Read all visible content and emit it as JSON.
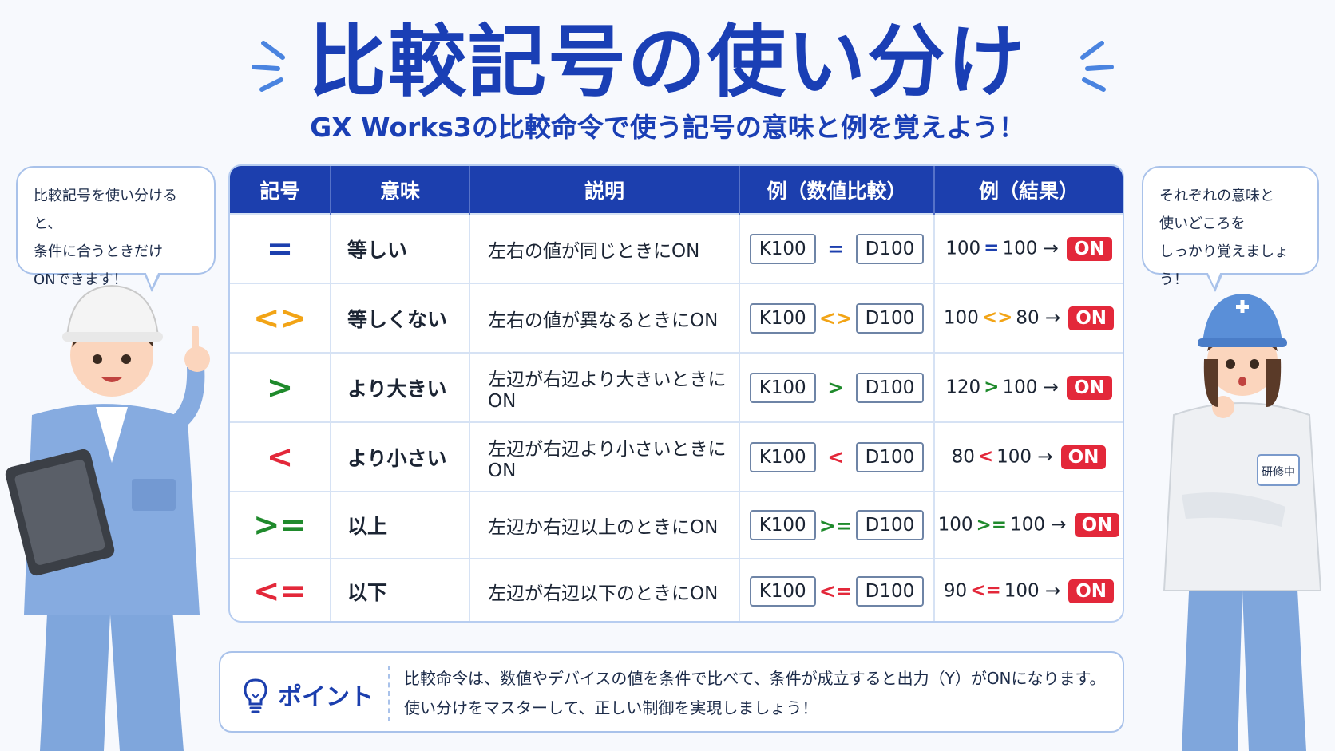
{
  "title": "比較記号の使い分け",
  "subtitle": "GX Works3の比較命令で使う記号の意味と例を覚えよう！",
  "bubble_left": [
    "比較記号を使い分けると、",
    "条件に合うときだけ",
    "ONできます！"
  ],
  "bubble_right": [
    "それぞれの意味と",
    "使いどころを",
    "しっかり覚えましょう！"
  ],
  "table": {
    "headers": [
      "記号",
      "意味",
      "説明",
      "例（数値比較）",
      "例（結果）"
    ],
    "rows": [
      {
        "symbol": "=",
        "color": "#1c3fae",
        "meaning": "等しい",
        "desc": "左右の値が同じときにON",
        "ex_left": "K100",
        "ex_right": "D100",
        "res_left": "100",
        "res_right": "100",
        "arrow": "→",
        "on": "ON"
      },
      {
        "symbol": "<>",
        "color": "#f2a416",
        "meaning": "等しくない",
        "desc": "左右の値が異なるときにON",
        "ex_left": "K100",
        "ex_right": "D100",
        "res_left": "100",
        "res_right": "80",
        "arrow": "→",
        "on": "ON"
      },
      {
        "symbol": ">",
        "color": "#1f8a2c",
        "meaning": "より大きい",
        "desc": "左辺が右辺より大きいときにON",
        "ex_left": "K100",
        "ex_right": "D100",
        "res_left": "120",
        "res_right": "100",
        "arrow": "→",
        "on": "ON"
      },
      {
        "symbol": "<",
        "color": "#e3283a",
        "meaning": "より小さい",
        "desc": "左辺が右辺より小さいときにON",
        "ex_left": "K100",
        "ex_right": "D100",
        "res_left": "80",
        "res_right": "100",
        "arrow": "→",
        "on": "ON"
      },
      {
        "symbol": ">=",
        "color": "#1f8a2c",
        "meaning": "以上",
        "desc": "左辺か右辺以上のときにON",
        "ex_left": "K100",
        "ex_right": "D100",
        "res_left": "100",
        "res_right": "100",
        "arrow": "→",
        "on": "ON"
      },
      {
        "symbol": "<=",
        "color": "#e3283a",
        "meaning": "以下",
        "desc": "左辺が右辺以下のときにON",
        "ex_left": "K100",
        "ex_right": "D100",
        "res_left": "90",
        "res_right": "100",
        "arrow": "→",
        "on": "ON"
      }
    ]
  },
  "point": {
    "label": "ポイント",
    "icon": "lightbulb-icon",
    "lines": [
      "比較命令は、数値やデバイスの値を条件で比べて、条件が成立すると出力（Y）がONになります。",
      "使い分けをマスターして、正しい制御を実現しましょう！"
    ]
  },
  "badge_text": "研修中",
  "colors": {
    "primary": "#1c3fae",
    "on": "#e3283a",
    "equal": "#1c3fae",
    "not_equal": "#f2a416",
    "greater": "#1f8a2c",
    "less": "#e3283a"
  }
}
